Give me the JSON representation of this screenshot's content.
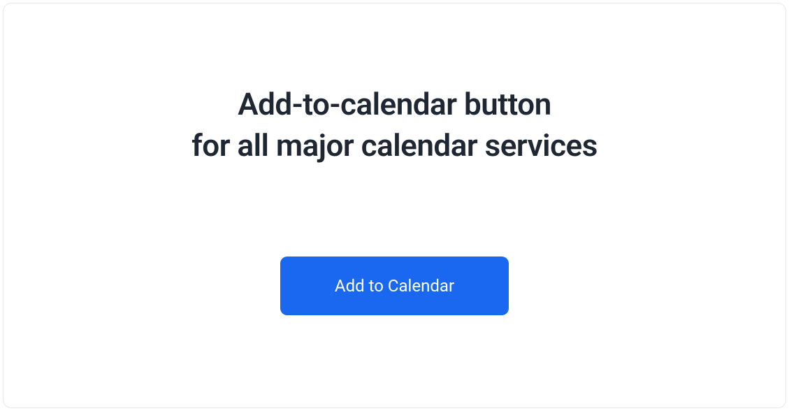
{
  "heading": {
    "line1": "Add-to-calendar button",
    "line2": "for all major calendar services"
  },
  "button": {
    "label": "Add to Calendar"
  }
}
